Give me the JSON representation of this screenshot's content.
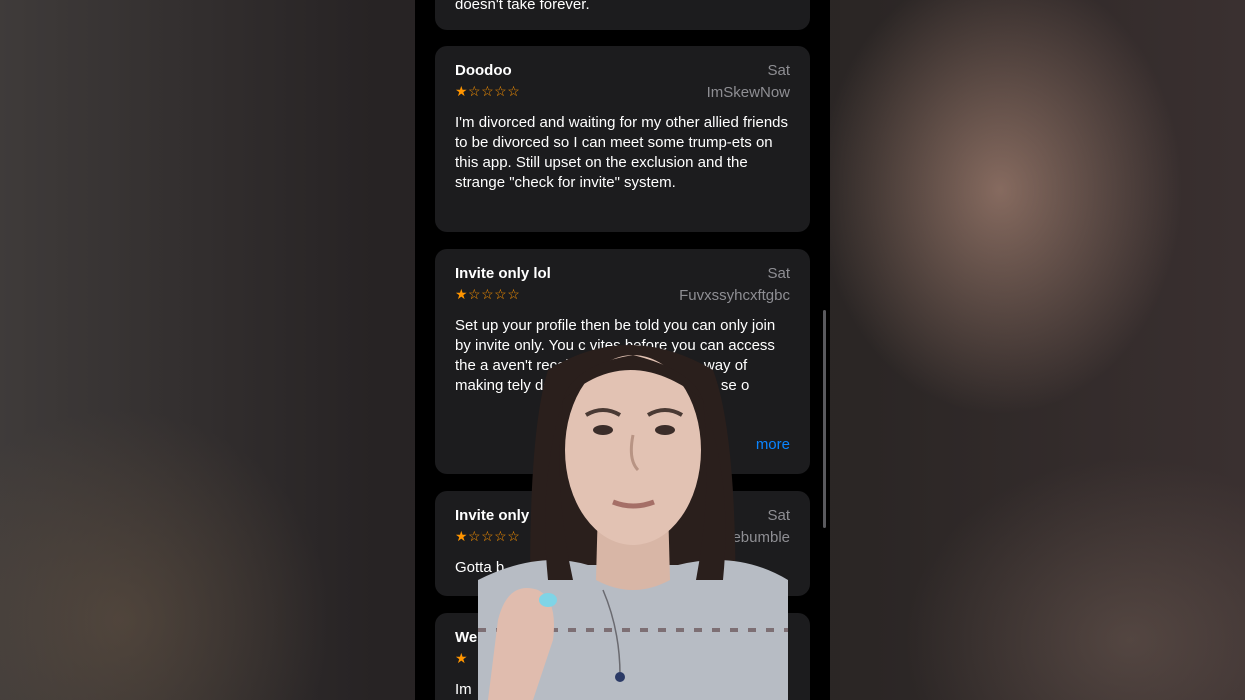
{
  "reviews": [
    {
      "body": "doesn't take forever."
    },
    {
      "title": "Doodoo",
      "date": "Sat",
      "user": "ImSkewNow",
      "rating_text": "★☆☆☆☆",
      "rating": 1,
      "body": "I'm divorced and waiting for my other allied friends to be divorced so I can meet some trump-ets on this app. Still upset on the exclusion and the strange \"check for invite\" system."
    },
    {
      "title": "Invite only lol",
      "date": "Sat",
      "user": "Fuvxssyhcxftgbc",
      "rating_text": "★☆☆☆☆",
      "rating": 1,
      "body": "Set up your profile then be told you can only join by invite only. You c vites before you can access the a aven't received an invi garbage way of making tely deleted it as i extremely sm se o",
      "more_label": "more"
    },
    {
      "title": "Invite only",
      "date": "Sat",
      "user": "tebumble",
      "rating_text": "★☆☆☆☆",
      "rating": 1,
      "body": "Gotta b"
    },
    {
      "title": "We",
      "rating_text": "★",
      "rating": 1,
      "body": "Im"
    }
  ],
  "colors": {
    "star": "#ff9500",
    "link": "#0a84ff",
    "card": "#1c1c1e",
    "muted": "#8e8e93"
  }
}
